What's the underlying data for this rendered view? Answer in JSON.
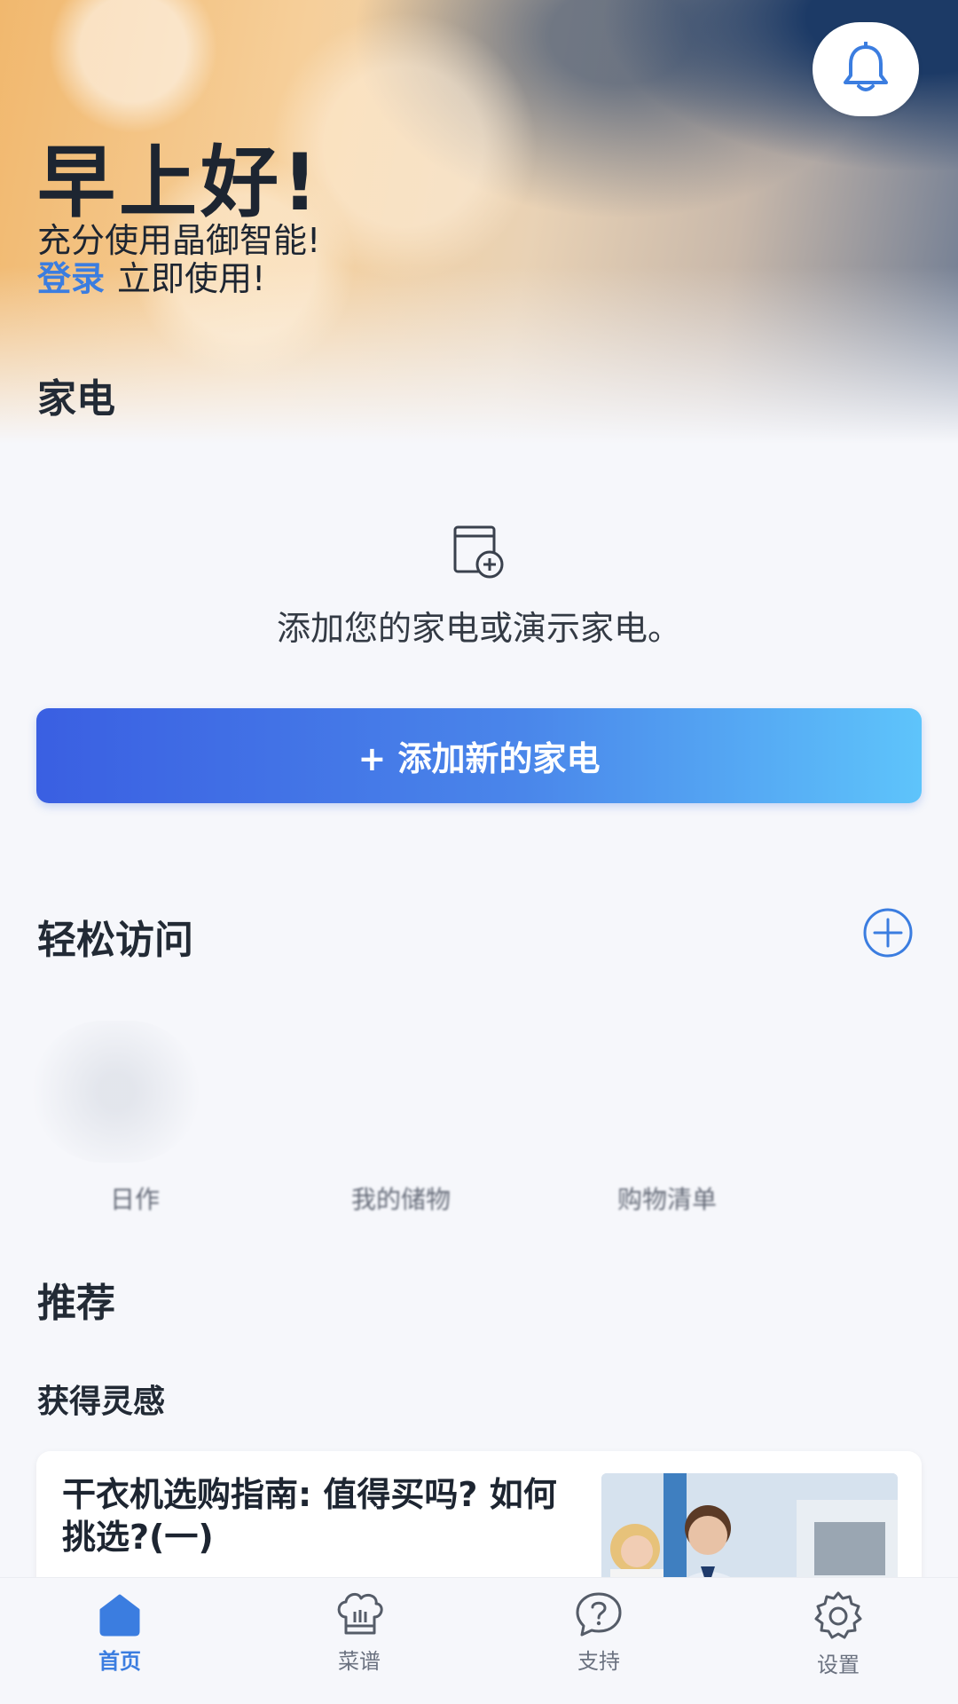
{
  "header": {
    "greeting": "早上好!",
    "subtitle": "充分使用晶御智能!",
    "login_link": "登录",
    "login_suffix": "立即使用!"
  },
  "appliances": {
    "section_title": "家电",
    "empty_text": "添加您的家电或演示家电。",
    "add_button_label": "+ 添加新的家电"
  },
  "quick_access": {
    "section_title": "轻松访问",
    "items": [
      {
        "label": "日作"
      },
      {
        "label": "我的储物"
      },
      {
        "label": "购物清单"
      }
    ]
  },
  "recommend": {
    "section_title": "推荐",
    "subsection_title": "获得灵感",
    "card": {
      "title": "干衣机选购指南: 值得买吗? 如何挑选?(一)"
    }
  },
  "tabbar": {
    "items": [
      {
        "label": "首页",
        "icon": "home-icon",
        "active": true
      },
      {
        "label": "菜谱",
        "icon": "chef-hat-icon",
        "active": false
      },
      {
        "label": "支持",
        "icon": "help-icon",
        "active": false
      },
      {
        "label": "设置",
        "icon": "gear-icon",
        "active": false
      }
    ]
  },
  "colors": {
    "accent": "#3b7de0",
    "button_gradient_start": "#3a5fe2",
    "button_gradient_end": "#5ec4fb"
  }
}
